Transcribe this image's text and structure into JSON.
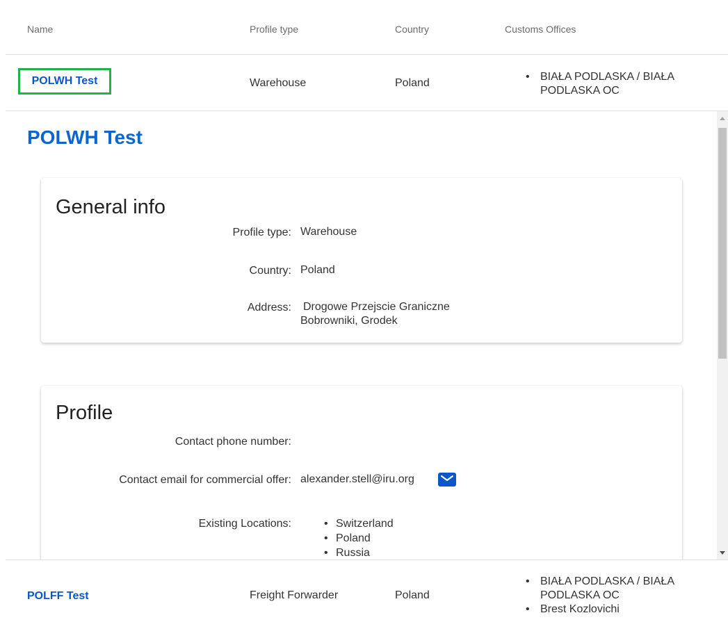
{
  "table": {
    "headers": {
      "name": "Name",
      "profile_type": "Profile type",
      "country": "Country",
      "customs_offices": "Customs Offices"
    },
    "rows": [
      {
        "name": "POLWH Test",
        "profile_type": "Warehouse",
        "country": "Poland",
        "customs_offices": [
          "BIAŁA PODLASKA / BIAŁA PODLASKA OC"
        ]
      },
      {
        "name": "POLFF Test",
        "profile_type": "Freight Forwarder",
        "country": "Poland",
        "customs_offices": [
          "BIAŁA PODLASKA / BIAŁA PODLASKA OC",
          "Brest Kozlovichi"
        ]
      }
    ]
  },
  "detail": {
    "title": "POLWH Test",
    "general_info": {
      "heading": "General info",
      "profile_type_label": "Profile type:",
      "profile_type_value": "Warehouse",
      "country_label": "Country:",
      "country_value": "Poland",
      "address_label": "Address:",
      "address_line1": "Drogowe Przejscie Graniczne",
      "address_line2": "Bobrowniki, Grodek"
    },
    "profile": {
      "heading": "Profile",
      "phone_label": "Contact phone number:",
      "phone_value": "",
      "email_label": "Contact email for commercial offer:",
      "email_value": "alexander.stell@iru.org",
      "locations_label": "Existing Locations:",
      "locations": [
        "Switzerland",
        "Poland",
        "Russia"
      ]
    }
  },
  "icons": {
    "mail": "mail-icon",
    "scroll_up": "arrow-up-icon",
    "scroll_down": "arrow-down-icon"
  },
  "colors": {
    "link": "#0b56c8",
    "detail_title": "#0b66d0",
    "selection_outline": "#22b14c"
  }
}
